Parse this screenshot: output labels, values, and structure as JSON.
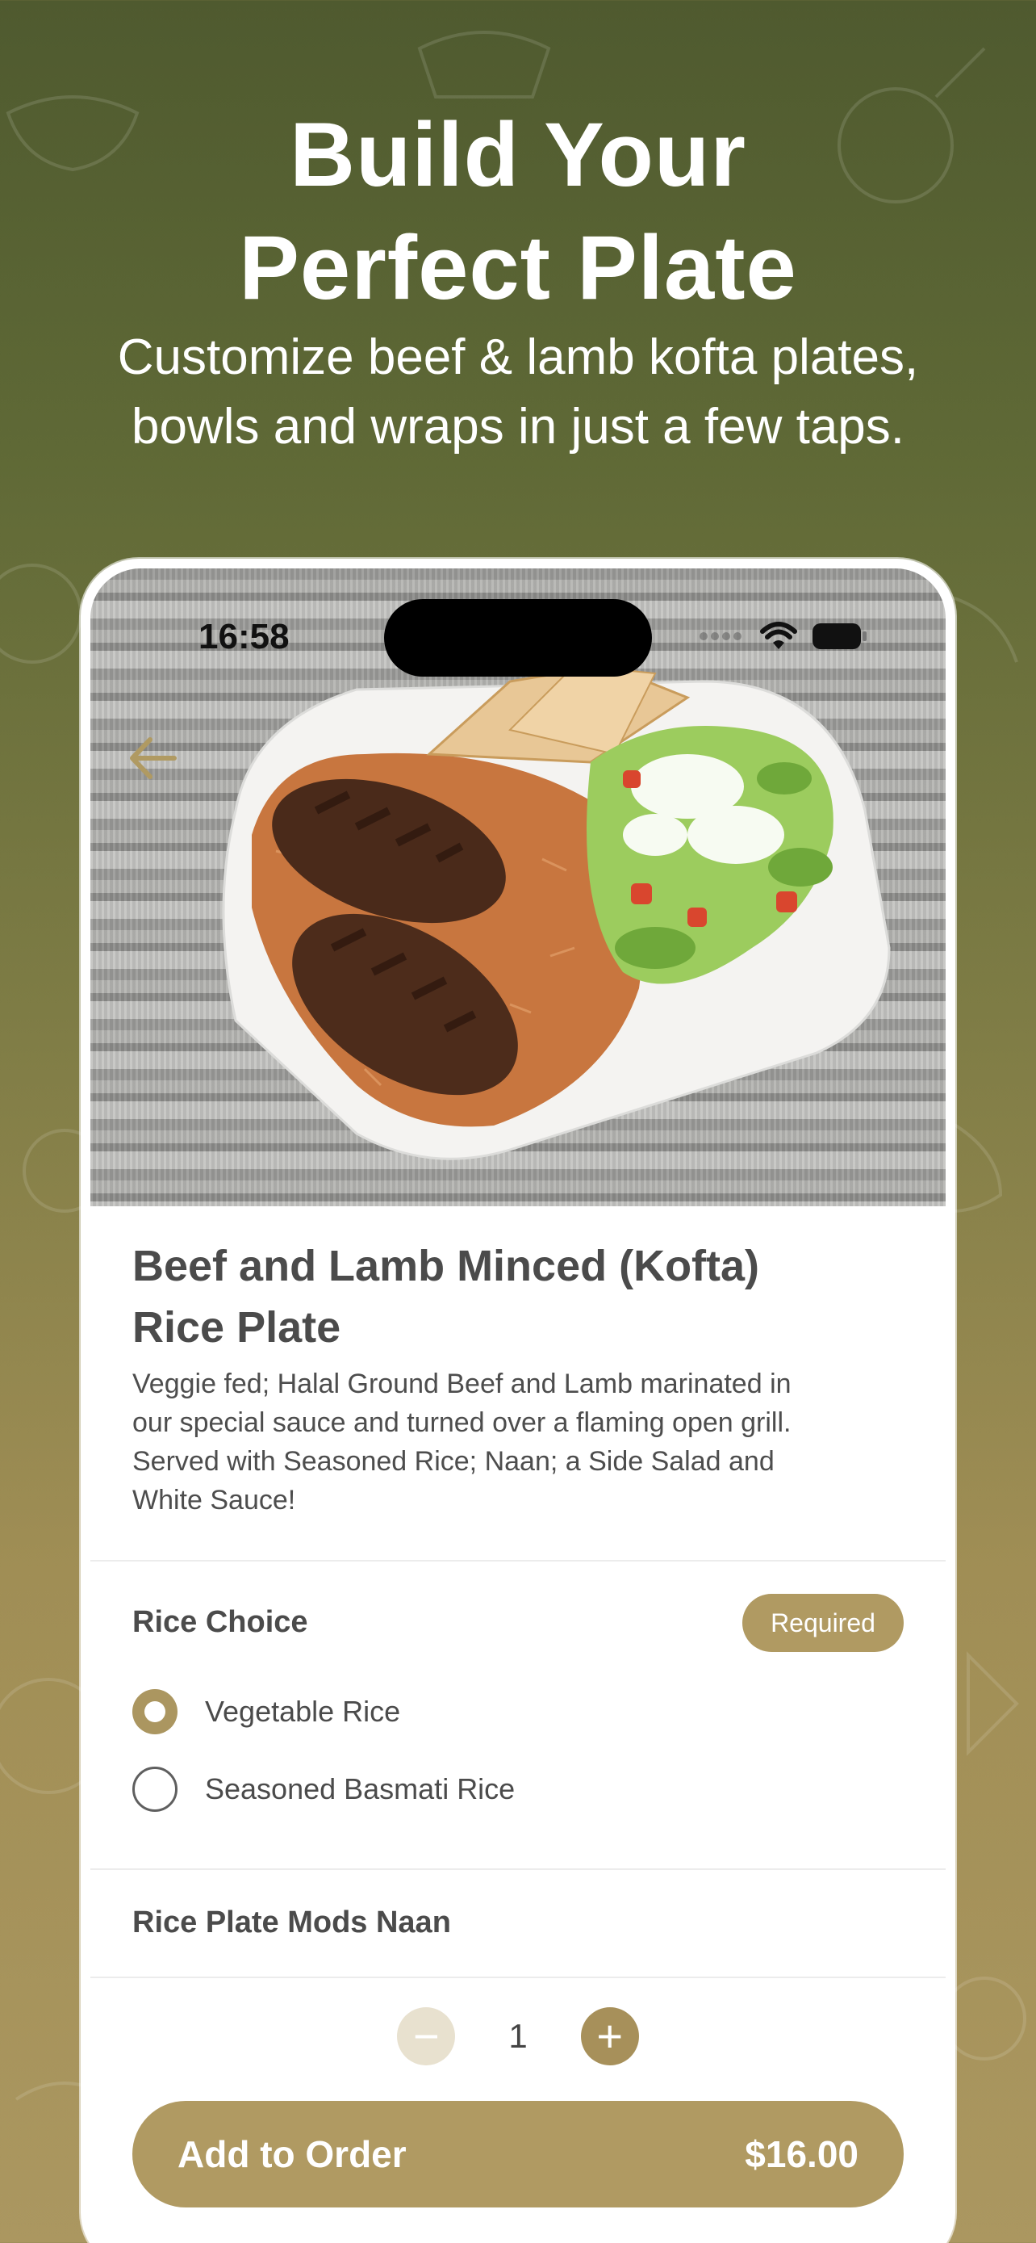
{
  "marketing": {
    "headline_line1": "Build Your",
    "headline_line2": "Perfect Plate",
    "subhead_line1": "Customize beef & lamb kofta plates,",
    "subhead_line2": "bowls and wraps in just a few taps."
  },
  "status_bar": {
    "time": "16:58"
  },
  "item": {
    "title_line1": "Beef and Lamb Minced (Kofta)",
    "title_line2": "Rice Plate",
    "desc_line1": "Veggie fed; Halal Ground Beef and Lamb marinated in",
    "desc_line2": "our special sauce and turned over a flaming open grill.",
    "desc_line3": "Served with Seasoned Rice; Naan; a Side Salad and",
    "desc_line4": "White Sauce!"
  },
  "rice_choice": {
    "title": "Rice Choice",
    "badge": "Required",
    "options": [
      {
        "label": "Vegetable Rice",
        "selected": true
      },
      {
        "label": "Seasoned Basmati Rice",
        "selected": false
      }
    ]
  },
  "mods": {
    "title": "Rice Plate Mods Naan"
  },
  "quantity": {
    "value": "1",
    "minus": "−",
    "plus": "+"
  },
  "cta": {
    "label": "Add to Order",
    "price": "$16.00"
  },
  "colors": {
    "accent": "#b09a62",
    "bg_top": "#4f5a2f",
    "bg_bottom": "#ab9760"
  },
  "icons": [
    "back-arrow-icon",
    "wifi-icon",
    "battery-icon",
    "cellular-icon"
  ]
}
